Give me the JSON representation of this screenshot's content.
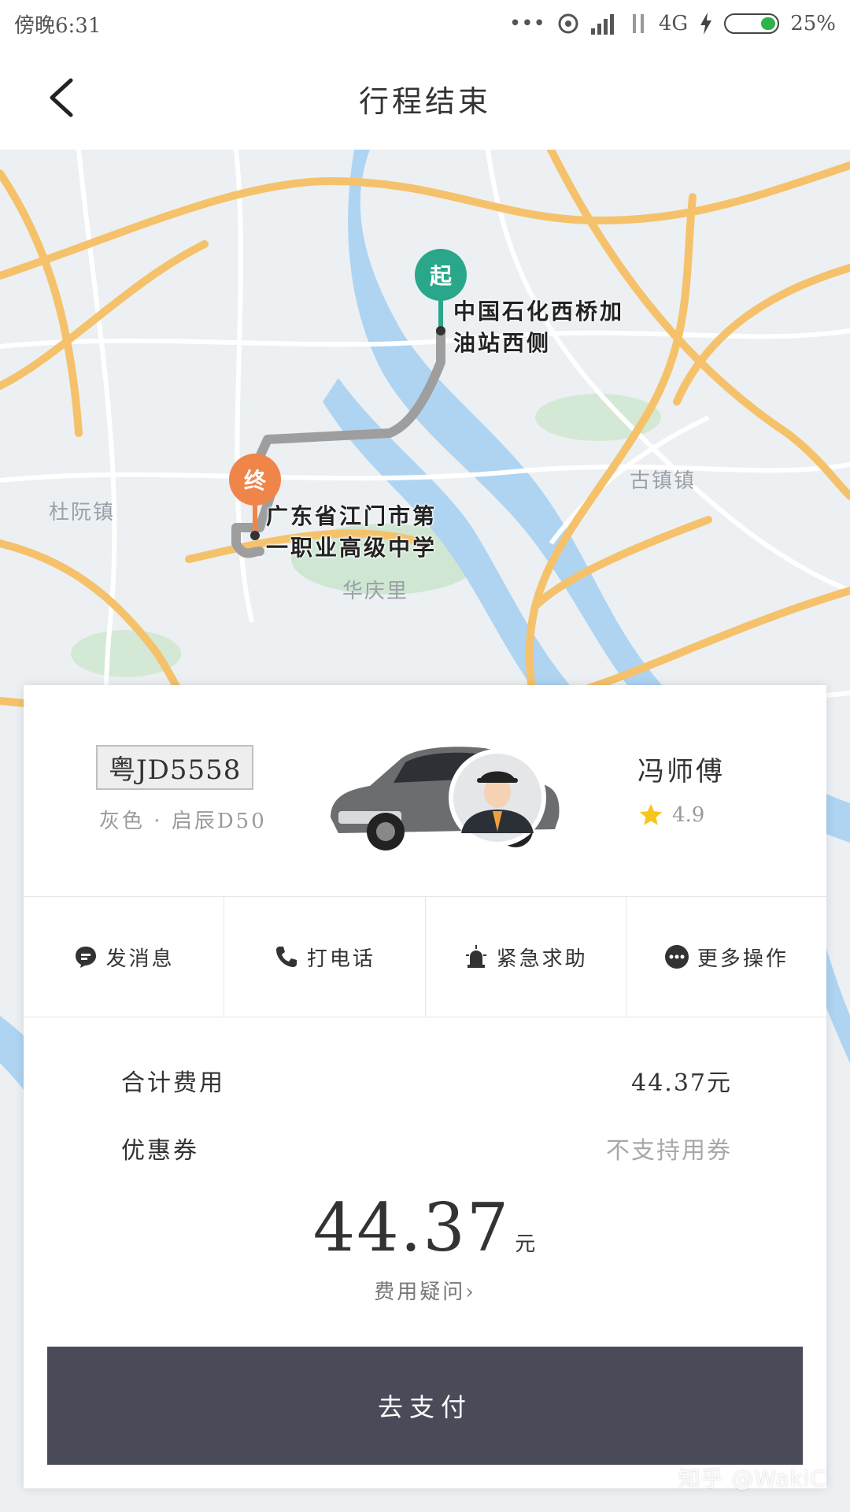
{
  "status_bar": {
    "time": "傍晚6:31",
    "network": "4G",
    "battery": "25%"
  },
  "header": {
    "title": "行程结束"
  },
  "map": {
    "start_marker": "起",
    "end_marker": "终",
    "start_address_line1": "中国石化西桥加",
    "start_address_line2": "油站西侧",
    "end_address_line1": "广东省江门市第",
    "end_address_line2": "一职业高级中学",
    "places": {
      "duruan": "杜阮镇",
      "guzhen": "古镇镇",
      "huaqingli": "华庆里"
    },
    "colors": {
      "start": "#2aa78a",
      "end": "#f0854a",
      "road": "#f5c26b",
      "river": "#aed4f2",
      "route": "#9e9e9e"
    }
  },
  "driver_card": {
    "plate": "粤JD5558",
    "car_color": "灰色",
    "car_model": "启辰D50",
    "driver_name": "冯师傅",
    "rating": "4.9"
  },
  "actions": [
    {
      "label": "发消息",
      "icon": "message-icon"
    },
    {
      "label": "打电话",
      "icon": "phone-icon"
    },
    {
      "label": "紧急求助",
      "icon": "alarm-icon"
    },
    {
      "label": "更多操作",
      "icon": "more-icon"
    }
  ],
  "fare": {
    "total_label": "合计费用",
    "total_value": "44.37元",
    "coupon_label": "优惠券",
    "coupon_value": "不支持用券",
    "amount": "44.37",
    "unit": "元",
    "question": "费用疑问"
  },
  "pay_button": "去支付",
  "watermark": "知乎 @WakiC"
}
